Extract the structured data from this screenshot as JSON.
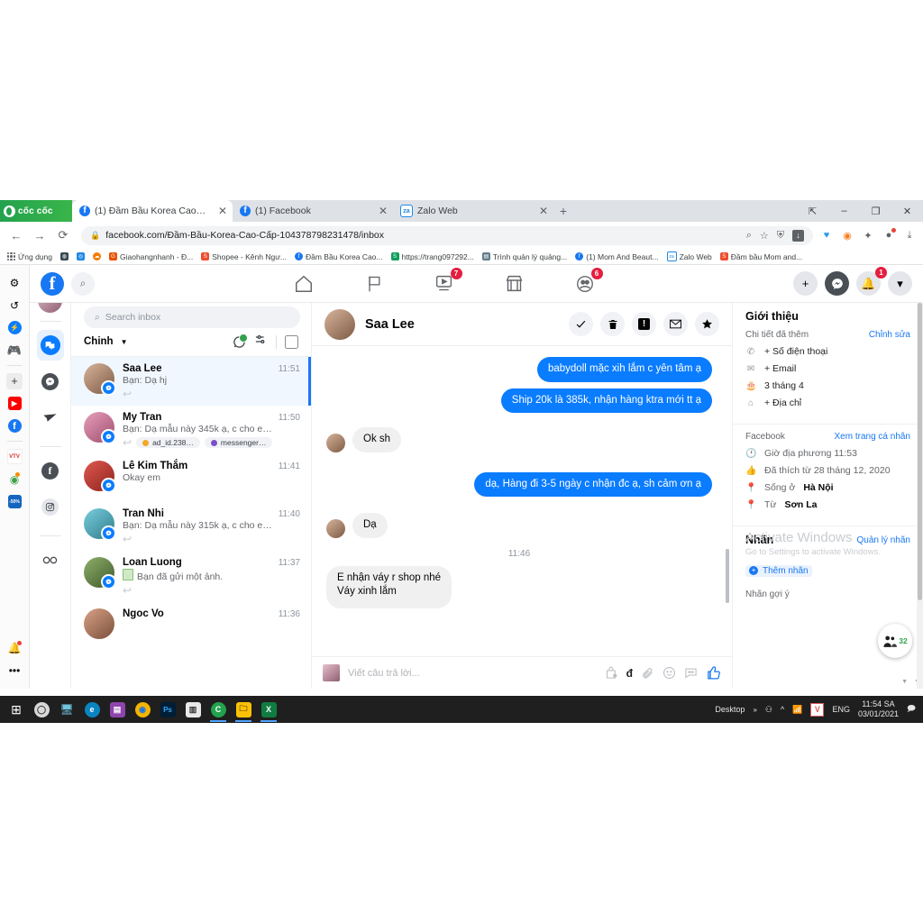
{
  "browser": {
    "brand": "cốc cốc",
    "tabs": [
      {
        "label": "(1) Đầm Bầu Korea Cao Cấp |",
        "icon": "facebook-icon",
        "active": true
      },
      {
        "label": "(1) Facebook",
        "icon": "facebook-icon",
        "active": false
      },
      {
        "label": "Zalo Web",
        "icon": "zalo-icon",
        "active": false
      }
    ],
    "new_tab": "+",
    "window_buttons": [
      "restore-down",
      "minimize",
      "maximize",
      "close"
    ],
    "url": "facebook.com/Đầm-Bầu-Korea-Cao-Cấp-104378798231478/inbox",
    "bookmarks": [
      {
        "label": "Ứng dụng",
        "icon": "apps-grid-icon",
        "color": "#4285f4"
      },
      {
        "label": "",
        "icon": "globe-icon",
        "color": "#37474f"
      },
      {
        "label": "",
        "icon": "compass-icon",
        "color": "#1e88e5"
      },
      {
        "label": "",
        "icon": "cloud-icon",
        "color": "#f57c00"
      },
      {
        "label": "Giaohangnhanh - Đ...",
        "icon": "ghn-icon",
        "color": "#e65100"
      },
      {
        "label": "Shopee - Kênh Ngư...",
        "icon": "shopee-icon",
        "color": "#ee4d2d"
      },
      {
        "label": "Đầm Bầu Korea Cao...",
        "icon": "facebook-icon",
        "color": "#1877f2"
      },
      {
        "label": "https://trang097292...",
        "icon": "sheets-icon",
        "color": "#0f9d58"
      },
      {
        "label": "Trình quản lý quảng...",
        "icon": "ads-manager-icon",
        "color": "#607d8b"
      },
      {
        "label": "(1) Mom And Beaut...",
        "icon": "facebook-icon",
        "color": "#1877f2"
      },
      {
        "label": "Zalo Web",
        "icon": "zalo-icon",
        "color": "#1e88e5"
      },
      {
        "label": "Đầm bầu Mom and...",
        "icon": "shopee-icon",
        "color": "#ee4d2d"
      }
    ]
  },
  "cocoroc_rail": [
    {
      "name": "settings-icon",
      "glyph": "⚙",
      "color": "#5f6368"
    },
    {
      "name": "history-icon",
      "glyph": "↺",
      "color": "#5f6368"
    },
    {
      "name": "messenger-icon",
      "glyph": "⚡",
      "color": "#0a7cff"
    },
    {
      "name": "game-controller-icon",
      "glyph": "🎮",
      "color": "#43a047"
    },
    {
      "name": "add-icon",
      "glyph": "+",
      "color": "#3c4043"
    },
    {
      "name": "youtube-icon",
      "glyph": "▶",
      "color": "#ff0000"
    },
    {
      "name": "facebook-icon",
      "glyph": "f",
      "color": "#1877f2"
    },
    {
      "name": "vtv-icon",
      "glyph": "VTV",
      "color": "#d32f2f"
    },
    {
      "name": "shopping-tag-icon",
      "glyph": "◉",
      "color": "#43a047"
    },
    {
      "name": "sale-50-icon",
      "glyph": "-50%",
      "color": "#1565c0"
    },
    {
      "name": "bell-icon",
      "glyph": "🔔",
      "color": "#3c4043"
    },
    {
      "name": "more-icon",
      "glyph": "•••",
      "color": "#3c4043"
    }
  ],
  "facebook_nav": {
    "logo": "f",
    "search_icon": "search-icon",
    "center_items": [
      {
        "name": "home-icon",
        "badge": ""
      },
      {
        "name": "pages-flag-icon",
        "badge": ""
      },
      {
        "name": "watch-video-icon",
        "badge": "7"
      },
      {
        "name": "marketplace-icon",
        "badge": ""
      },
      {
        "name": "groups-icon",
        "badge": "6"
      }
    ],
    "right_items": [
      {
        "name": "create-plus-button",
        "glyph": "+",
        "badge": ""
      },
      {
        "name": "messenger-button",
        "glyph": "m",
        "badge": ""
      },
      {
        "name": "notifications-button",
        "glyph": "🔔",
        "badge": "1"
      },
      {
        "name": "account-menu-button",
        "glyph": "▾",
        "badge": ""
      }
    ]
  },
  "messenger_rail": [
    {
      "name": "page-avatar",
      "type": "avatar"
    },
    {
      "name": "inbox-chats-tab",
      "selected": true
    },
    {
      "name": "messenger-tab",
      "selected": false
    },
    {
      "name": "send-paper-plane-tab",
      "selected": false
    },
    {
      "name": "facebook-channel-tab",
      "selected": false
    },
    {
      "name": "instagram-channel-tab",
      "selected": false
    },
    {
      "name": "infinity-tab",
      "selected": false
    }
  ],
  "inbox": {
    "search_placeholder": "Search inbox",
    "filter_label": "Chinh",
    "conversations": [
      {
        "name": "Saa Lee",
        "time": "11:51",
        "snippet": "Bạn: Dạ hj",
        "selected": true,
        "has_reply_icon": true,
        "tags": [],
        "photo": false,
        "avatar_colors": [
          "#c9a18a",
          "#7d5a44"
        ]
      },
      {
        "name": "My Tran",
        "time": "11:50",
        "snippet": "Bạn: Dạ mẫu này 345k ạ, c cho e…",
        "selected": false,
        "has_reply_icon": true,
        "photo": false,
        "tags": [
          {
            "label": "ad_id.238…",
            "color": "#f5a623"
          },
          {
            "label": "messenger…",
            "color": "#7b4fc9"
          }
        ],
        "avatar_colors": [
          "#e07ba0",
          "#9e4d6d"
        ]
      },
      {
        "name": "Lê Kim Thắm",
        "time": "11:41",
        "snippet": "Okay em",
        "selected": false,
        "has_reply_icon": false,
        "tags": [],
        "photo": false,
        "avatar_colors": [
          "#d03b34",
          "#8c221d"
        ]
      },
      {
        "name": "Tran Nhi",
        "time": "11:40",
        "snippet": "Bạn: Dạ mẫu này 315k ạ, c cho e…",
        "selected": false,
        "has_reply_icon": true,
        "tags": [],
        "photo": false,
        "avatar_colors": [
          "#57b3c9",
          "#2f7b8c"
        ]
      },
      {
        "name": "Loan Luong",
        "time": "11:37",
        "snippet": "Bạn đã gửi một ảnh.",
        "selected": false,
        "has_reply_icon": true,
        "tags": [],
        "photo": true,
        "avatar_colors": [
          "#6d8f4e",
          "#3e5a2b"
        ]
      },
      {
        "name": "Ngoc Vo",
        "time": "11:36",
        "snippet": "",
        "selected": false,
        "has_reply_icon": false,
        "tags": [],
        "photo": false,
        "avatar_colors": [
          "#c98a6d",
          "#7a4f3a"
        ]
      }
    ]
  },
  "thread": {
    "title": "Saa Lee",
    "actions": [
      {
        "name": "mark-done-button",
        "glyph": "✓"
      },
      {
        "name": "delete-button",
        "glyph": "🗑"
      },
      {
        "name": "report-spam-button",
        "glyph": "!"
      },
      {
        "name": "mark-unread-button",
        "glyph": "✉"
      },
      {
        "name": "star-button",
        "glyph": "★"
      }
    ],
    "messages": [
      {
        "side": "out",
        "text": "babydoll mặc xih lắm c yên tâm ạ"
      },
      {
        "side": "out",
        "text": "Ship 20k là 385k, nhận hàng ktra mới tt ạ"
      },
      {
        "side": "in",
        "text": "Ok sh"
      },
      {
        "side": "out",
        "text": "dạ, Hàng đi 3-5 ngày c nhận đc ạ, sh cảm ơn ạ"
      },
      {
        "side": "in",
        "text": "Dạ"
      }
    ],
    "timestamp": "11:46",
    "last_message": {
      "side": "in",
      "lines": [
        "E nhận váy r shop nhé",
        "Váy xinh lắm"
      ]
    },
    "composer": {
      "placeholder": "Viết câu trả lời...",
      "icons": [
        {
          "name": "saved-replies-icon",
          "glyph": "🛍"
        },
        {
          "name": "dong-currency-icon",
          "glyph": "đ"
        },
        {
          "name": "attachment-icon",
          "glyph": "📎"
        },
        {
          "name": "emoji-icon",
          "glyph": "☺"
        },
        {
          "name": "quick-reply-icon",
          "glyph": "💬"
        },
        {
          "name": "like-thumbs-up-icon",
          "glyph": "👍"
        }
      ]
    }
  },
  "right_panel": {
    "about_title": "Giới thiệu",
    "details_label": "Chi tiết đã thêm",
    "edit_link": "Chỉnh sửa",
    "details": [
      {
        "icon": "phone-icon",
        "text": "+ Số điện thoại"
      },
      {
        "icon": "email-icon",
        "text": "+ Email"
      },
      {
        "icon": "cake-icon",
        "text": "3 tháng 4"
      },
      {
        "icon": "home-icon",
        "text": "+ Địa chỉ"
      }
    ],
    "facebook_label": "Facebook",
    "profile_link": "Xem trang cá nhân",
    "facebook_details": [
      {
        "icon": "clock-icon",
        "text": "Giờ địa phương 11:53",
        "bold": ""
      },
      {
        "icon": "thumbs-up-icon",
        "text": "Đã thích từ 28 tháng 12, 2020",
        "bold": ""
      },
      {
        "icon": "pin-icon",
        "text": "Sống ở ",
        "bold": "Hà Nội"
      },
      {
        "icon": "pin-icon",
        "text": "Từ ",
        "bold": "Sơn La"
      }
    ],
    "labels_title": "Nhãn",
    "manage_labels": "Quản lý nhãn",
    "add_label": "Thêm nhãn",
    "suggested_labels": "Nhãn gợi ý",
    "floating_badge": "32"
  },
  "watermark": {
    "line1": "Activate Windows",
    "line2": "Go to Settings to activate Windows."
  },
  "taskbar": {
    "items": [
      {
        "name": "start-button",
        "glyph": "⊞",
        "color": "#0078d7",
        "open": false
      },
      {
        "name": "cortana-search",
        "glyph": "◯",
        "color": "#d8d8d8",
        "open": false
      },
      {
        "name": "task-view",
        "glyph": "🖥",
        "color": "#6fc3df",
        "open": false
      },
      {
        "name": "edge-icon",
        "glyph": "e",
        "color": "#0a84c1",
        "open": false
      },
      {
        "name": "winrar-icon",
        "glyph": "▤",
        "color": "#8e44ad",
        "open": false
      },
      {
        "name": "chrome-icon",
        "glyph": "◉",
        "color": "#f4b400",
        "open": false
      },
      {
        "name": "photoshop-icon",
        "glyph": "Ps",
        "color": "#001e36",
        "open": false
      },
      {
        "name": "microsoft-store-icon",
        "glyph": "▥",
        "color": "#e8e8e8",
        "open": false
      },
      {
        "name": "coccoc-icon",
        "glyph": "C",
        "color": "#23a24d",
        "open": true
      },
      {
        "name": "file-explorer-icon",
        "glyph": "🗀",
        "color": "#ffc107",
        "open": true
      },
      {
        "name": "excel-icon",
        "glyph": "X",
        "color": "#107c41",
        "open": true
      }
    ],
    "desktop_label": "Desktop",
    "overflow": "»",
    "tray": [
      {
        "name": "people-icon",
        "glyph": "⚇"
      },
      {
        "name": "show-hidden-icons",
        "glyph": "^"
      },
      {
        "name": "wifi-icon",
        "glyph": "📶"
      },
      {
        "name": "v-antivirus-icon",
        "glyph": "V"
      },
      {
        "name": "language-indicator",
        "glyph": "ENG"
      }
    ],
    "time": "11:54 SA",
    "date": "03/01/2021",
    "action_center": "💬"
  }
}
